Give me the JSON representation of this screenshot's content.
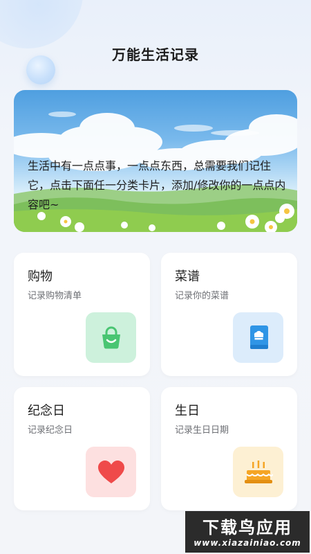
{
  "app": {
    "title": "万能生活记录"
  },
  "banner": {
    "text": "生活中有一点点事，一点点东西，总需要我们记住它，点击下面任一分类卡片，添加/修改你的一点点内容吧~"
  },
  "categories": [
    {
      "title": "购物",
      "subtitle": "记录购物清单",
      "icon": "shopping-bag-icon",
      "icon_bg": "#cdf1dc",
      "icon_color": "#49c572"
    },
    {
      "title": "菜谱",
      "subtitle": "记录你的菜谱",
      "icon": "recipe-book-icon",
      "icon_bg": "#dcecfb",
      "icon_color": "#2f95e6"
    },
    {
      "title": "纪念日",
      "subtitle": "记录纪念日",
      "icon": "heart-icon",
      "icon_bg": "#fde0e0",
      "icon_color": "#ef4a4a"
    },
    {
      "title": "生日",
      "subtitle": "记录生日日期",
      "icon": "birthday-cake-icon",
      "icon_bg": "#fdf0d3",
      "icon_color": "#f5a524"
    }
  ],
  "watermark": {
    "main": "下载鸟应用",
    "sub": "www.xiazainiao.com"
  }
}
